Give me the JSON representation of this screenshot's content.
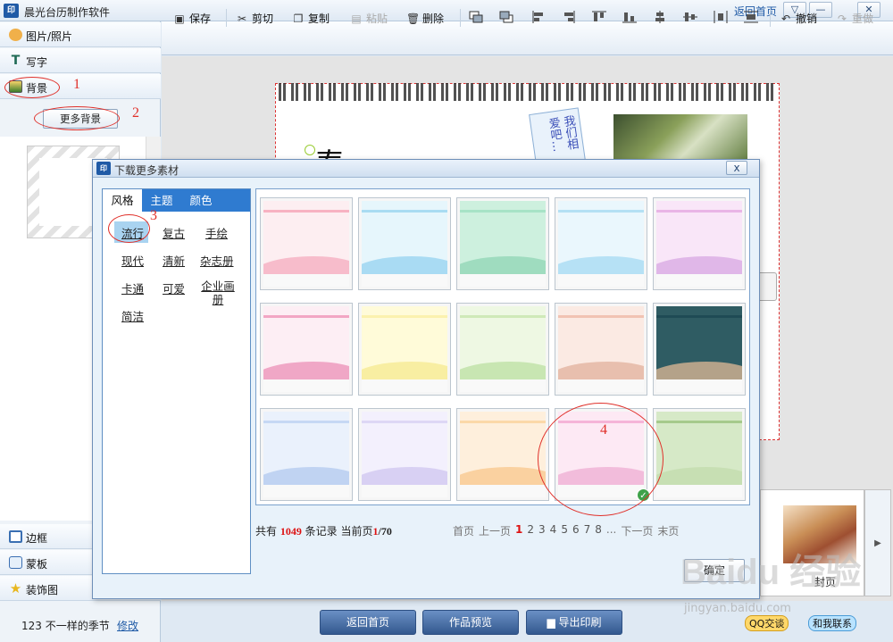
{
  "app": {
    "title": "晨光台历制作软件",
    "logo": "印",
    "back_home": "返回首页",
    "window_buttons": [
      "▽",
      "—",
      "✕"
    ]
  },
  "sidebar": {
    "items": [
      {
        "label": "图片/照片",
        "icon": "photo-icon"
      },
      {
        "label": "写字",
        "icon": "text-icon"
      },
      {
        "label": "背景",
        "icon": "background-icon"
      }
    ],
    "more_backgrounds": "更多背景",
    "bottom_items": [
      {
        "label": "边框",
        "icon": "frame-icon"
      },
      {
        "label": "蒙板",
        "icon": "mask-icon"
      },
      {
        "label": "装饰图",
        "icon": "star-icon"
      }
    ],
    "status_name": "123 不一样的季节",
    "status_edit": "修改"
  },
  "annotations": [
    "1",
    "2",
    "3",
    "4"
  ],
  "toolbar": {
    "save": "保存",
    "cut": "剪切",
    "copy": "复制",
    "paste": "粘贴",
    "delete": "删除",
    "undo": "撤销",
    "redo": "重做"
  },
  "canvas": {
    "note_text": "我们相爱吧…",
    "big_letter": "春"
  },
  "page_strip": {
    "label": "封页"
  },
  "bottom_buttons": {
    "back_home": "返回首页",
    "preview": "作品预览",
    "export_print": "导出印刷"
  },
  "footer_badges": {
    "qq_chat": "QQ交谈",
    "contact": "和我联系"
  },
  "watermark": {
    "brand": "Baidu 经验",
    "url": "jingyan.baidu.com"
  },
  "dialog": {
    "title": "下载更多素材",
    "logo": "印",
    "close": "x",
    "tabs": [
      "风格",
      "主题",
      "颜色"
    ],
    "options": [
      "流行",
      "复古",
      "手绘",
      "现代",
      "清新",
      "杂志册",
      "卡通",
      "可爱",
      "企业画册",
      "简洁"
    ],
    "selected_option": "流行",
    "tiles": [
      {
        "band": "#f7b2c2",
        "wave": "#f7bccb",
        "bg": "#fdeef1"
      },
      {
        "band": "#a9dcf2",
        "wave": "#a9dbf3",
        "bg": "#e6f6fc"
      },
      {
        "band": "#a7e3c6",
        "wave": "#9fdcbf",
        "bg": "#cdf0de"
      },
      {
        "band": "#b4e0f4",
        "wave": "#b6e1f5",
        "bg": "#eaf7fd"
      },
      {
        "band": "#e9b5e6",
        "wave": "#e0b7e8",
        "bg": "#f9e6f8"
      },
      {
        "band": "#f2a6c4",
        "wave": "#f0a7c6",
        "bg": "#fdeef4"
      },
      {
        "band": "#fbf1ae",
        "wave": "#f8eea2",
        "bg": "#fffbd9"
      },
      {
        "band": "#cfe9b8",
        "wave": "#c8e6b2",
        "bg": "#eef8e3"
      },
      {
        "band": "#f1c3b3",
        "wave": "#e8bfae",
        "bg": "#fbeae3"
      },
      {
        "band": "#1f4b55",
        "wave": "#b4a289",
        "bg": "#2f5c63"
      },
      {
        "band": "#c6d8f4",
        "wave": "#c0d3f2",
        "bg": "#eaf1fc"
      },
      {
        "band": "#ddd7f5",
        "wave": "#d8d0f3",
        "bg": "#f3f0fd"
      },
      {
        "band": "#fbd8a8",
        "wave": "#fad1a0",
        "bg": "#feefdc"
      },
      {
        "band": "#f5b4d8",
        "wave": "#f2bcdb",
        "bg": "#fde9f4"
      },
      {
        "band": "#a6ca8c",
        "wave": "#c7dfb3",
        "bg": "#d6e9c7"
      }
    ],
    "records_prefix": "共有",
    "records_count": "1049",
    "records_mid": "条记录  当前页",
    "current_page": "1",
    "total_pages": "/70",
    "pager": {
      "first": "首页",
      "prev": "上一页",
      "pages": [
        "1",
        "2",
        "3",
        "4",
        "5",
        "6",
        "7",
        "8"
      ],
      "ellipsis": "...",
      "next": "下一页",
      "last": "末页"
    },
    "confirm": "确定"
  }
}
